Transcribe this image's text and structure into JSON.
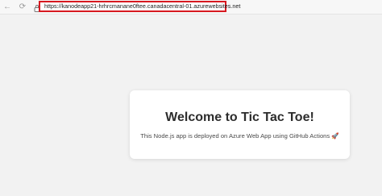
{
  "browser": {
    "url": "https://kanodeapp21-hrhrcmanane0ftee.canadacentral-01.azurewebsites.net",
    "back_icon": "←",
    "reload_icon": "⟳",
    "highlight_color": "#d71920"
  },
  "page": {
    "title": "Welcome to Tic Tac Toe!",
    "subtitle": "This Node.js app is deployed on Azure Web App using GitHub Actions 🚀"
  }
}
